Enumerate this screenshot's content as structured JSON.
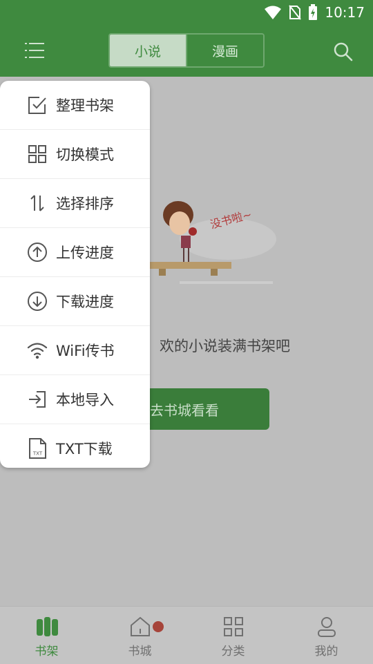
{
  "status_bar": {
    "time": "10:17"
  },
  "header": {
    "tabs": [
      {
        "label": "小说",
        "active": true
      },
      {
        "label": "漫画",
        "active": false
      }
    ]
  },
  "menu": {
    "items": [
      {
        "label": "整理书架",
        "icon": "checkbox-icon"
      },
      {
        "label": "切换模式",
        "icon": "grid-icon"
      },
      {
        "label": "选择排序",
        "icon": "sort-icon"
      },
      {
        "label": "上传进度",
        "icon": "upload-icon"
      },
      {
        "label": "下载进度",
        "icon": "download-icon"
      },
      {
        "label": "WiFi传书",
        "icon": "wifi-icon"
      },
      {
        "label": "本地导入",
        "icon": "import-icon"
      },
      {
        "label": "TXT下载",
        "icon": "txt-file-icon"
      }
    ]
  },
  "empty_state": {
    "illustration_text": "没书啦~",
    "message": "欢的小说装满书架吧",
    "button_label": "去书城看看"
  },
  "bottom_nav": {
    "items": [
      {
        "label": "书架",
        "icon": "bookshelf-icon",
        "active": true
      },
      {
        "label": "书城",
        "icon": "home-icon",
        "active": false,
        "badge": true
      },
      {
        "label": "分类",
        "icon": "category-icon",
        "active": false
      },
      {
        "label": "我的",
        "icon": "profile-icon",
        "active": false
      }
    ]
  },
  "colors": {
    "primary": "#3f8a3f",
    "overlay_bg": "#bdbdbd",
    "badge": "#a6443a"
  }
}
